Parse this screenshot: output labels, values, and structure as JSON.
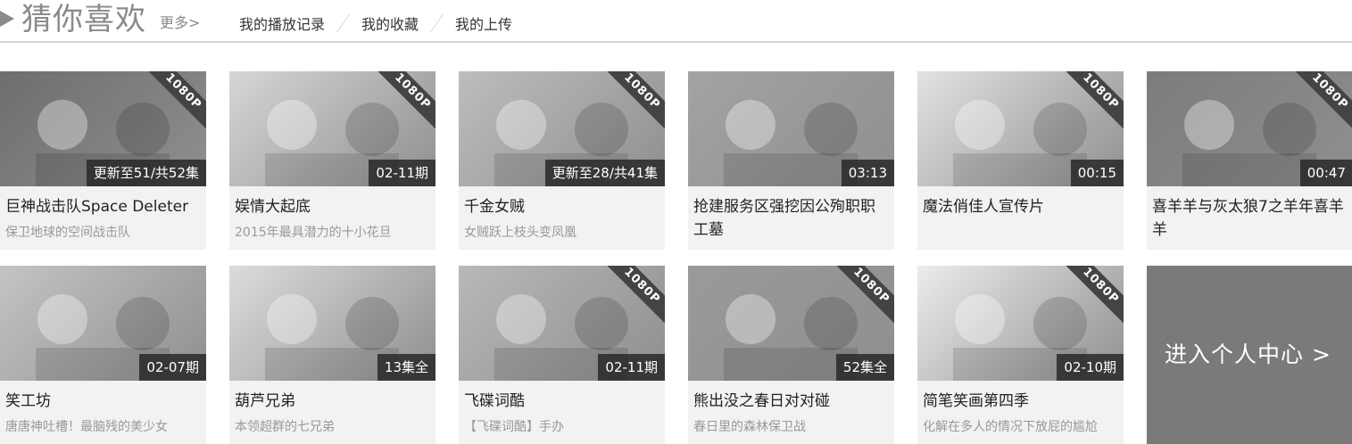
{
  "header": {
    "title": "猜你喜欢",
    "more": "更多>",
    "nav": [
      "我的播放记录",
      "我的收藏",
      "我的上传"
    ]
  },
  "cards": [
    {
      "title": "巨神战击队Space Deleter",
      "subtitle": "保卫地球的空间战击队",
      "badge": "更新至51/共52集",
      "ribbon": "1080P"
    },
    {
      "title": "娱情大起底",
      "subtitle": "2015年最具潜力的十小花旦",
      "badge": "02-11期",
      "ribbon": "1080P"
    },
    {
      "title": "千金女贼",
      "subtitle": "女贼跃上枝头变凤凰",
      "badge": "更新至28/共41集",
      "ribbon": "1080P"
    },
    {
      "title": "抢建服务区强挖因公殉职职工墓",
      "subtitle": "",
      "badge": "03:13",
      "ribbon": ""
    },
    {
      "title": "魔法俏佳人宣传片",
      "subtitle": "",
      "badge": "00:15",
      "ribbon": "1080P"
    },
    {
      "title": "喜羊羊与灰太狼7之羊年喜羊羊",
      "subtitle": "",
      "badge": "00:47",
      "ribbon": "1080P"
    },
    {
      "title": "笑工坊",
      "subtitle": "唐唐神吐槽！最脑残的美少女",
      "badge": "02-07期",
      "ribbon": ""
    },
    {
      "title": "葫芦兄弟",
      "subtitle": "本领超群的七兄弟",
      "badge": "13集全",
      "ribbon": ""
    },
    {
      "title": "飞碟词酷",
      "subtitle": "【飞碟词酷】手办",
      "badge": "02-11期",
      "ribbon": "1080P"
    },
    {
      "title": "熊出没之春日对对碰",
      "subtitle": "春日里的森林保卫战",
      "badge": "52集全",
      "ribbon": "1080P"
    },
    {
      "title": "简笔笑画第四季",
      "subtitle": "化解在多人的情况下放屁的尴尬",
      "badge": "02-10期",
      "ribbon": "1080P"
    }
  ],
  "personal_center": "进入个人中心 >"
}
